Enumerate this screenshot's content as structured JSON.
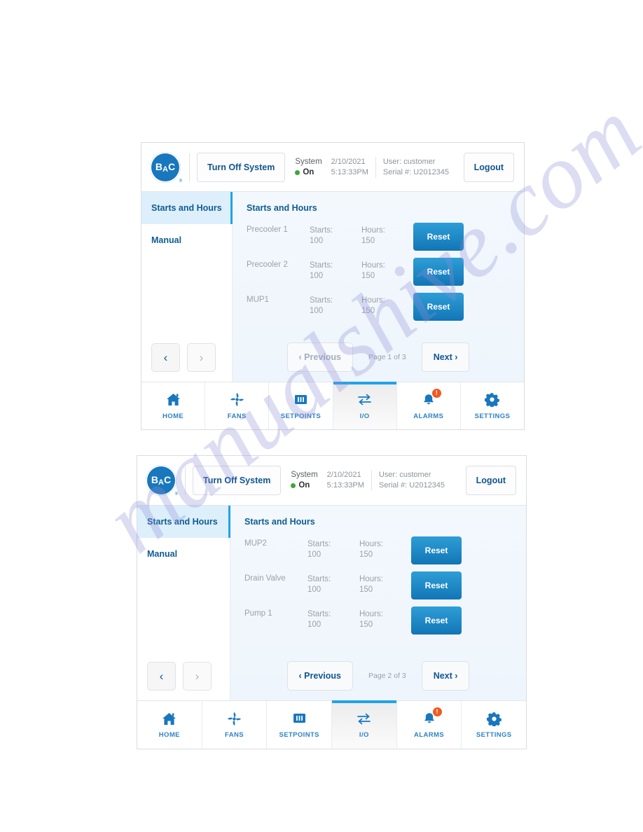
{
  "panels": [
    {
      "header": {
        "logo_text": "BAC",
        "turn_off_label": "Turn Off System",
        "system_label": "System",
        "system_state": "On",
        "date": "2/10/2021",
        "time": "5:13:33PM",
        "user": "User: customer",
        "serial": "Serial #: U2012345",
        "logout_label": "Logout"
      },
      "sidebar": {
        "items": [
          {
            "label": "Starts and Hours",
            "active": true
          },
          {
            "label": "Manual",
            "active": false
          }
        ],
        "prev_icon": "chevron-left-icon",
        "next_icon": "chevron-right-icon"
      },
      "content": {
        "title": "Starts and Hours",
        "starts_label": "Starts:",
        "hours_label": "Hours:",
        "reset_label": "Reset",
        "rows": [
          {
            "name": "Precooler 1",
            "starts": "100",
            "hours": "150"
          },
          {
            "name": "Precooler 2",
            "starts": "100",
            "hours": "150"
          },
          {
            "name": "MUP1",
            "starts": "100",
            "hours": "150"
          }
        ]
      },
      "pager": {
        "previous_label": "‹ Previous",
        "page_label": "Page 1 of 3",
        "next_label": "Next ›"
      },
      "bottom_nav": [
        {
          "label": "HOME",
          "icon": "house-icon",
          "active": false,
          "badge": ""
        },
        {
          "label": "FANS",
          "icon": "fan-icon",
          "active": false,
          "badge": ""
        },
        {
          "label": "SETPOINTS",
          "icon": "sliders-icon",
          "active": false,
          "badge": ""
        },
        {
          "label": "I/O",
          "icon": "exchange-arrows-icon",
          "active": true,
          "badge": ""
        },
        {
          "label": "ALARMS",
          "icon": "bell-icon",
          "active": false,
          "badge": "!"
        },
        {
          "label": "SETTINGS",
          "icon": "gear-icon",
          "active": false,
          "badge": ""
        }
      ]
    },
    {
      "header": {
        "logo_text": "BAC",
        "turn_off_label": "Turn Off System",
        "system_label": "System",
        "system_state": "On",
        "date": "2/10/2021",
        "time": "5:13:33PM",
        "user": "User: customer",
        "serial": "Serial #: U2012345",
        "logout_label": "Logout"
      },
      "sidebar": {
        "items": [
          {
            "label": "Starts and Hours",
            "active": true
          },
          {
            "label": "Manual",
            "active": false
          }
        ],
        "prev_icon": "chevron-left-icon",
        "next_icon": "chevron-right-icon"
      },
      "content": {
        "title": "Starts and Hours",
        "starts_label": "Starts:",
        "hours_label": "Hours:",
        "reset_label": "Reset",
        "rows": [
          {
            "name": "MUP2",
            "starts": "100",
            "hours": "150"
          },
          {
            "name": "Drain Valve",
            "starts": "100",
            "hours": "150"
          },
          {
            "name": "Pump 1",
            "starts": "100",
            "hours": "150"
          }
        ]
      },
      "pager": {
        "previous_label": "‹ Previous",
        "page_label": "Page 2 of 3",
        "next_label": "Next ›"
      },
      "bottom_nav": [
        {
          "label": "HOME",
          "icon": "house-icon",
          "active": false,
          "badge": ""
        },
        {
          "label": "FANS",
          "icon": "fan-icon",
          "active": false,
          "badge": ""
        },
        {
          "label": "SETPOINTS",
          "icon": "sliders-icon",
          "active": false,
          "badge": ""
        },
        {
          "label": "I/O",
          "icon": "exchange-arrows-icon",
          "active": true,
          "badge": ""
        },
        {
          "label": "ALARMS",
          "icon": "bell-icon",
          "active": false,
          "badge": "!"
        },
        {
          "label": "SETTINGS",
          "icon": "gear-icon",
          "active": false,
          "badge": ""
        }
      ]
    }
  ],
  "watermark": {
    "text": "manualshive.com"
  },
  "colors": {
    "brand_blue": "#1877bd",
    "accent_blue": "#21a3e8",
    "dark_blue": "#11558f",
    "status_green": "#3fa535",
    "badge_orange": "#ef5a20"
  }
}
